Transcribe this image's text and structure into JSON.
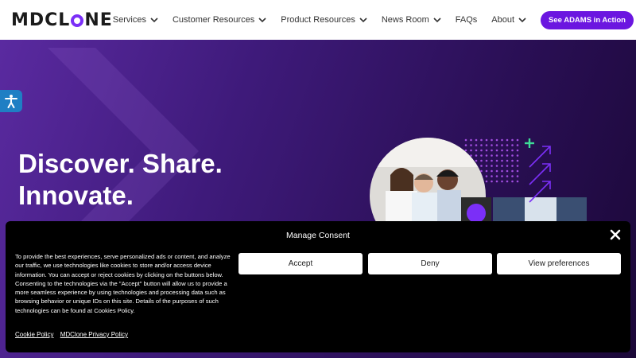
{
  "header": {
    "logo_text": "MDCLONE",
    "nav": [
      {
        "label": "Services"
      },
      {
        "label": "Customer Resources"
      },
      {
        "label": "Product Resources"
      },
      {
        "label": "News Room"
      },
      {
        "label": "FAQs"
      },
      {
        "label": "About"
      }
    ],
    "cta_label": "See ADAMS in Action",
    "colors": {
      "brand": "#6b16e0",
      "logo_ring": "#7b2ff7"
    }
  },
  "hero": {
    "title_line1": "Discover. Share.",
    "title_line2": "Innovate.",
    "accessibility_icon": "accessibility-icon",
    "colors": {
      "background": "#3e1a7a",
      "accent_green": "#3ddc97"
    }
  },
  "consent": {
    "title": "Manage Consent",
    "text": "To provide the best experiences, serve personalized ads or content, and analyze our traffic, we use technologies like cookies to store and/or access device information. You can accept or reject cookies by clicking on the buttons below. Consenting to the technologies via the \"Accept\" button will allow us to provide a more seamless experience by using technologies and processing data such as browsing behavior or unique IDs on this site. Details of the purposes of such technologies can be found at Cookies Policy.",
    "buttons": {
      "accept": "Accept",
      "deny": "Deny",
      "preferences": "View preferences"
    },
    "links": {
      "cookie_policy": "Cookie Policy",
      "privacy_policy": "MDClone Privacy Policy"
    }
  }
}
